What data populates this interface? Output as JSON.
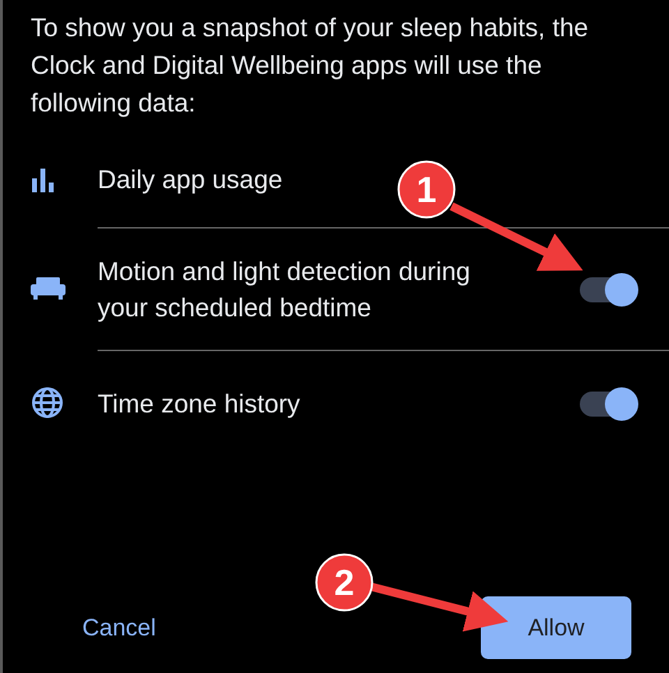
{
  "intro": "To show you a snapshot of your sleep habits, the Clock and Digital Wellbeing apps will use the following data:",
  "items": [
    {
      "label": "Daily app usage",
      "kind": "plain"
    },
    {
      "label": "Motion and light detection during your scheduled bedtime",
      "kind": "toggle",
      "on": true
    },
    {
      "label": "Time zone history",
      "kind": "toggle",
      "on": true
    }
  ],
  "buttons": [
    {
      "label": "Cancel",
      "kind": "text"
    },
    {
      "label": "Allow",
      "kind": "filled"
    }
  ],
  "callouts": [
    {
      "label": "1"
    },
    {
      "label": "2"
    }
  ]
}
